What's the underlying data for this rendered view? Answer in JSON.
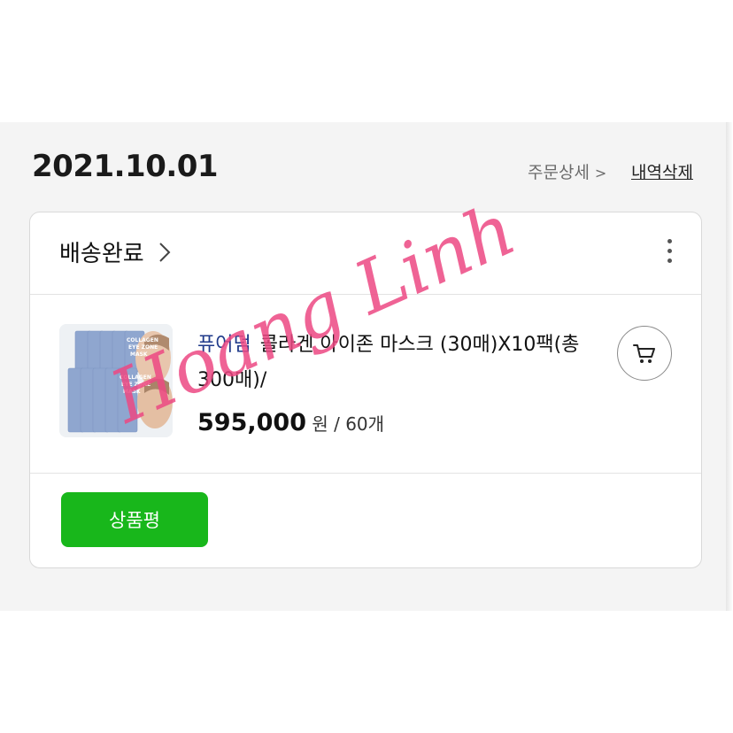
{
  "order": {
    "date": "2021.10.01",
    "detail_link": "주문상세",
    "delete_link": "내역삭제"
  },
  "card": {
    "status": "배송완료",
    "product": {
      "brand": "퓨어덤",
      "name": "콜라겐 아이존 마스크 (30매)X10팩(총300매)/",
      "price": "595,000",
      "currency": "원",
      "quantity": " / 60개",
      "image_label": "COLLAGEN EYE ZONE MASK"
    },
    "review_button": "상품평"
  },
  "watermark": "Hoang Linh",
  "colors": {
    "review_button": "#18b71b",
    "brand_text": "#1f3a8a",
    "watermark": "#ec4882",
    "panel_bg": "#f4f4f4"
  },
  "icons": [
    "chevron-right-icon",
    "more-vertical-icon",
    "cart-icon"
  ]
}
